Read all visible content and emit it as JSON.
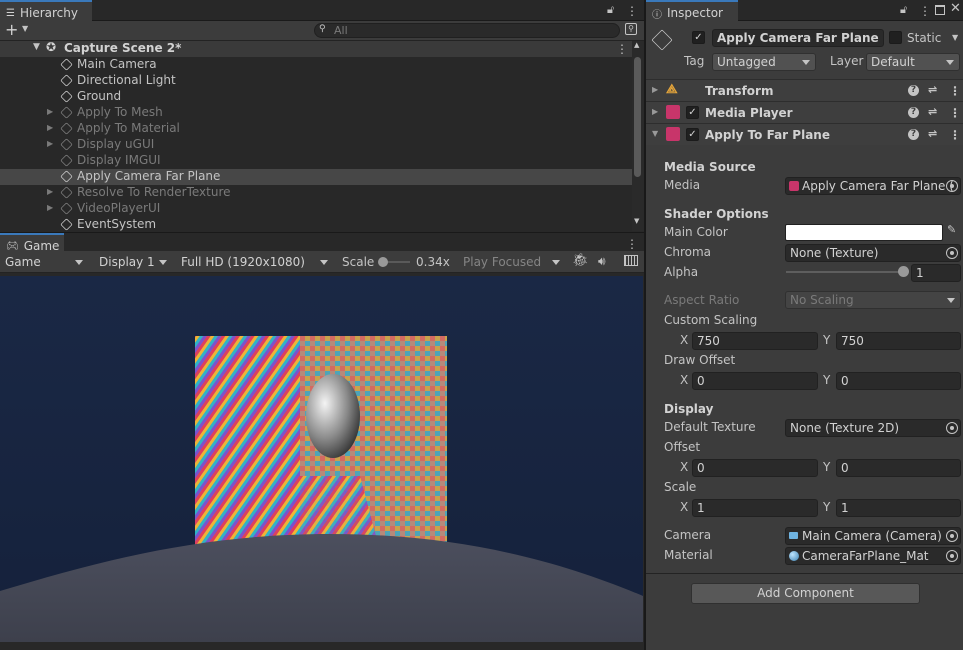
{
  "hierarchy": {
    "tab_label": "Hierarchy",
    "search_placeholder": "All",
    "scene_name": "Capture Scene 2*",
    "items": [
      {
        "label": "Main Camera",
        "active": true,
        "expandable": false
      },
      {
        "label": "Directional Light",
        "active": true,
        "expandable": false
      },
      {
        "label": "Ground",
        "active": true,
        "expandable": false
      },
      {
        "label": "Apply To Mesh",
        "active": false,
        "expandable": true
      },
      {
        "label": "Apply To Material",
        "active": false,
        "expandable": true
      },
      {
        "label": "Display uGUI",
        "active": false,
        "expandable": true
      },
      {
        "label": "Display IMGUI",
        "active": false,
        "expandable": false
      },
      {
        "label": "Apply Camera Far Plane",
        "active": true,
        "expandable": false,
        "selected": true
      },
      {
        "label": "Resolve To RenderTexture",
        "active": false,
        "expandable": true
      },
      {
        "label": "VideoPlayerUI",
        "active": false,
        "expandable": true
      },
      {
        "label": "EventSystem",
        "active": true,
        "expandable": false
      }
    ]
  },
  "game": {
    "tab_label": "Game",
    "view_mode": "Game",
    "display": "Display 1",
    "resolution": "Full HD (1920x1080)",
    "scale_label": "Scale",
    "scale_value": "0.34x",
    "play_mode": "Play Focused"
  },
  "inspector": {
    "tab_label": "Inspector",
    "object_name": "Apply Camera Far Plane",
    "static_label": "Static",
    "tag_label": "Tag",
    "tag_value": "Untagged",
    "layer_label": "Layer",
    "layer_value": "Default",
    "components": [
      "Transform",
      "Media Player",
      "Apply To Far Plane"
    ],
    "media_source_header": "Media Source",
    "media_label": "Media",
    "media_value": "Apply Camera Far Plane (",
    "shader_options_header": "Shader Options",
    "main_color_label": "Main Color",
    "chroma_label": "Chroma",
    "chroma_value": "None (Texture)",
    "alpha_label": "Alpha",
    "alpha_value": "1",
    "alpha_fraction": 1.0,
    "aspect_ratio_label": "Aspect Ratio",
    "aspect_ratio_value": "No Scaling",
    "custom_scaling_label": "Custom Scaling",
    "custom_scaling_x": "750",
    "custom_scaling_y": "750",
    "draw_offset_label": "Draw Offset",
    "draw_offset_x": "0",
    "draw_offset_y": "0",
    "display_header": "Display",
    "default_texture_label": "Default Texture",
    "default_texture_value": "None (Texture 2D)",
    "offset_label": "Offset",
    "offset_x": "0",
    "offset_y": "0",
    "scale_label": "Scale",
    "scale_x": "1",
    "scale_y": "1",
    "camera_label": "Camera",
    "camera_value": "Main Camera (Camera)",
    "material_label": "Material",
    "material_value": "CameraFarPlane_Mat",
    "add_component_label": "Add Component",
    "x_label": "X",
    "y_label": "Y"
  }
}
